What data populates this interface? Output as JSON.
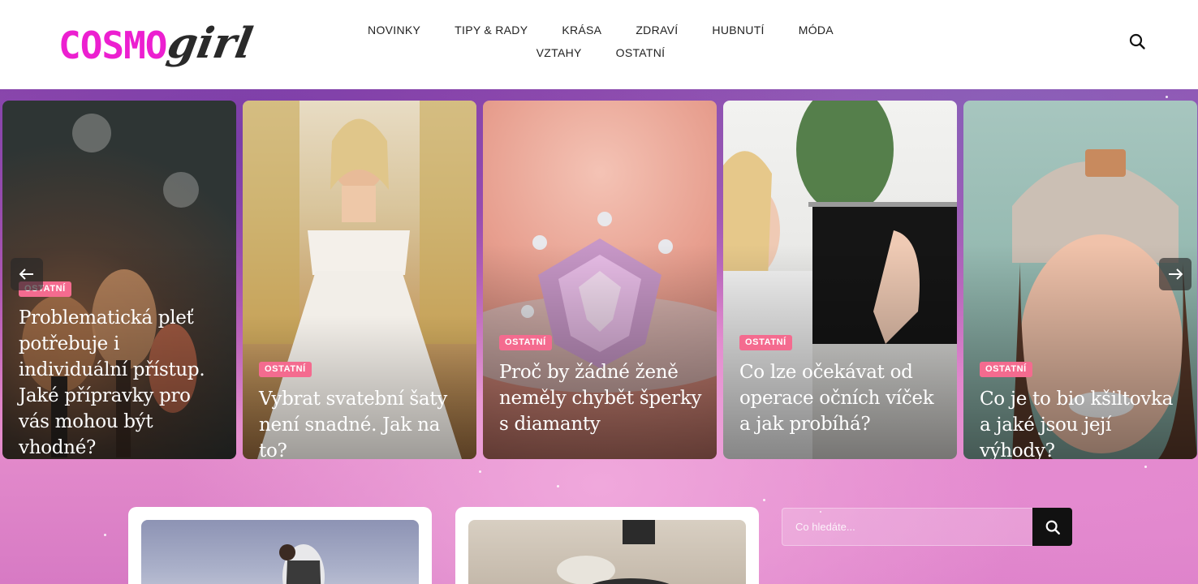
{
  "brand": {
    "logo_part1": "COSMO",
    "logo_part2": "girl",
    "color_primary": "#ec1fd0"
  },
  "nav": {
    "items": [
      "NOVINKY",
      "TIPY & RADY",
      "KRÁSA",
      "ZDRAVÍ",
      "HUBNUTÍ",
      "MÓDA",
      "VZTAHY",
      "OSTATNÍ"
    ]
  },
  "header": {
    "search_icon": "search-icon"
  },
  "carousel": {
    "badge_color": "#f46b8f",
    "cards": [
      {
        "category": "OSTATNÍ",
        "title": "Problematická pleť potřebuje i individuální přístup. Jaké přípravky pro vás mohou být vhodné?"
      },
      {
        "category": "OSTATNÍ",
        "title": "Vybrat svatební šaty není snadné. Jak na to?"
      },
      {
        "category": "OSTATNÍ",
        "title": "Proč by žádné ženě neměly chybět šperky s diamanty"
      },
      {
        "category": "OSTATNÍ",
        "title": "Co lze očekávat od operace očních víček a jak probíhá?"
      },
      {
        "category": "OSTATNÍ",
        "title": "Co je to bio kšiltovka a jaké jsou její výhody?"
      }
    ],
    "prev_icon": "arrow-left-icon",
    "next_icon": "arrow-right-icon"
  },
  "sidebar": {
    "search_placeholder": "Co hledáte..."
  }
}
